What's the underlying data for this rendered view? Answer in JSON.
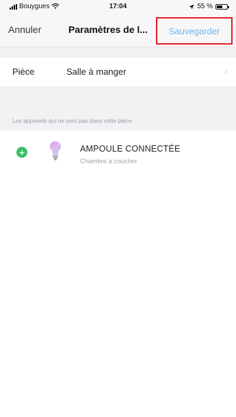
{
  "status_bar": {
    "carrier": "Bouygues",
    "time": "17:04",
    "battery": "55 %",
    "battery_level": 0.55,
    "icons": [
      "signal-icon",
      "wifi-icon",
      "location-icon",
      "battery-icon"
    ]
  },
  "nav": {
    "cancel_label": "Annuler",
    "title": "Paramètres de l...",
    "save_label": "Sauvegarder"
  },
  "room": {
    "label": "Pièce",
    "value": "Salle à manger"
  },
  "devices_section": {
    "header": "Les appareils qui ne sont pas dans cette pièce",
    "items": [
      {
        "name": "AMPOULE CONNECTÉE",
        "room": "Chambre à coucher",
        "icon": "bulb-icon",
        "action_icon": "add-icon"
      }
    ]
  },
  "colors": {
    "accent": "#6fb3e8",
    "add": "#3bbf63",
    "highlight": "#e01b24"
  }
}
